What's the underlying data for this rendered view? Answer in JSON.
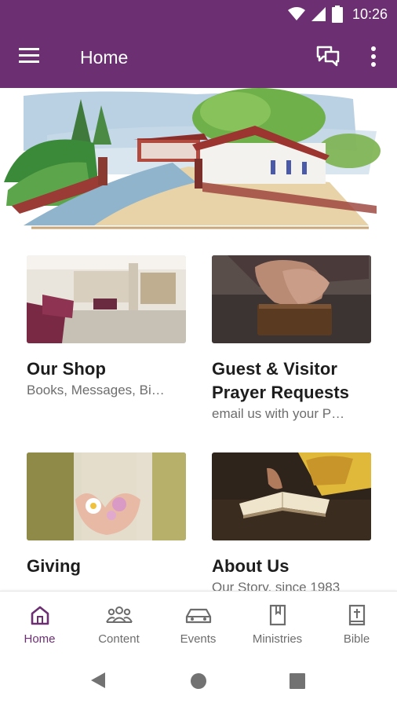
{
  "status_bar": {
    "time": "10:26",
    "icons": [
      "wifi-icon",
      "cell-signal-icon",
      "battery-icon"
    ]
  },
  "app_bar": {
    "title": "Home",
    "background": "#6b2f72",
    "icons": [
      "menu-icon",
      "chat-icon",
      "more-vert-icon"
    ]
  },
  "banner": {
    "image": "watercolor-church-illustration"
  },
  "cards": [
    {
      "title": "Our Shop",
      "subtitle": "Books, Messages, Bi…",
      "image": "shop-lobby-photo"
    },
    {
      "title": "Guest & Visitor Prayer Requests",
      "subtitle": "email us with your P…",
      "image": "praying-hands-photo"
    },
    {
      "title": "Giving",
      "subtitle": "",
      "image": "hands-flowers-photo"
    },
    {
      "title": "About Us",
      "subtitle": "Our Story, since 1983",
      "image": "open-bible-photo"
    }
  ],
  "bottom_nav": {
    "active": "Home",
    "active_color": "#6b2f72",
    "items": [
      {
        "label": "Home",
        "icon": "home-icon"
      },
      {
        "label": "Content",
        "icon": "people-icon"
      },
      {
        "label": "Events",
        "icon": "car-icon"
      },
      {
        "label": "Ministries",
        "icon": "book-icon"
      },
      {
        "label": "Bible",
        "icon": "bible-icon"
      }
    ]
  },
  "system_nav": [
    "back-icon",
    "home-circle-icon",
    "recents-icon"
  ]
}
